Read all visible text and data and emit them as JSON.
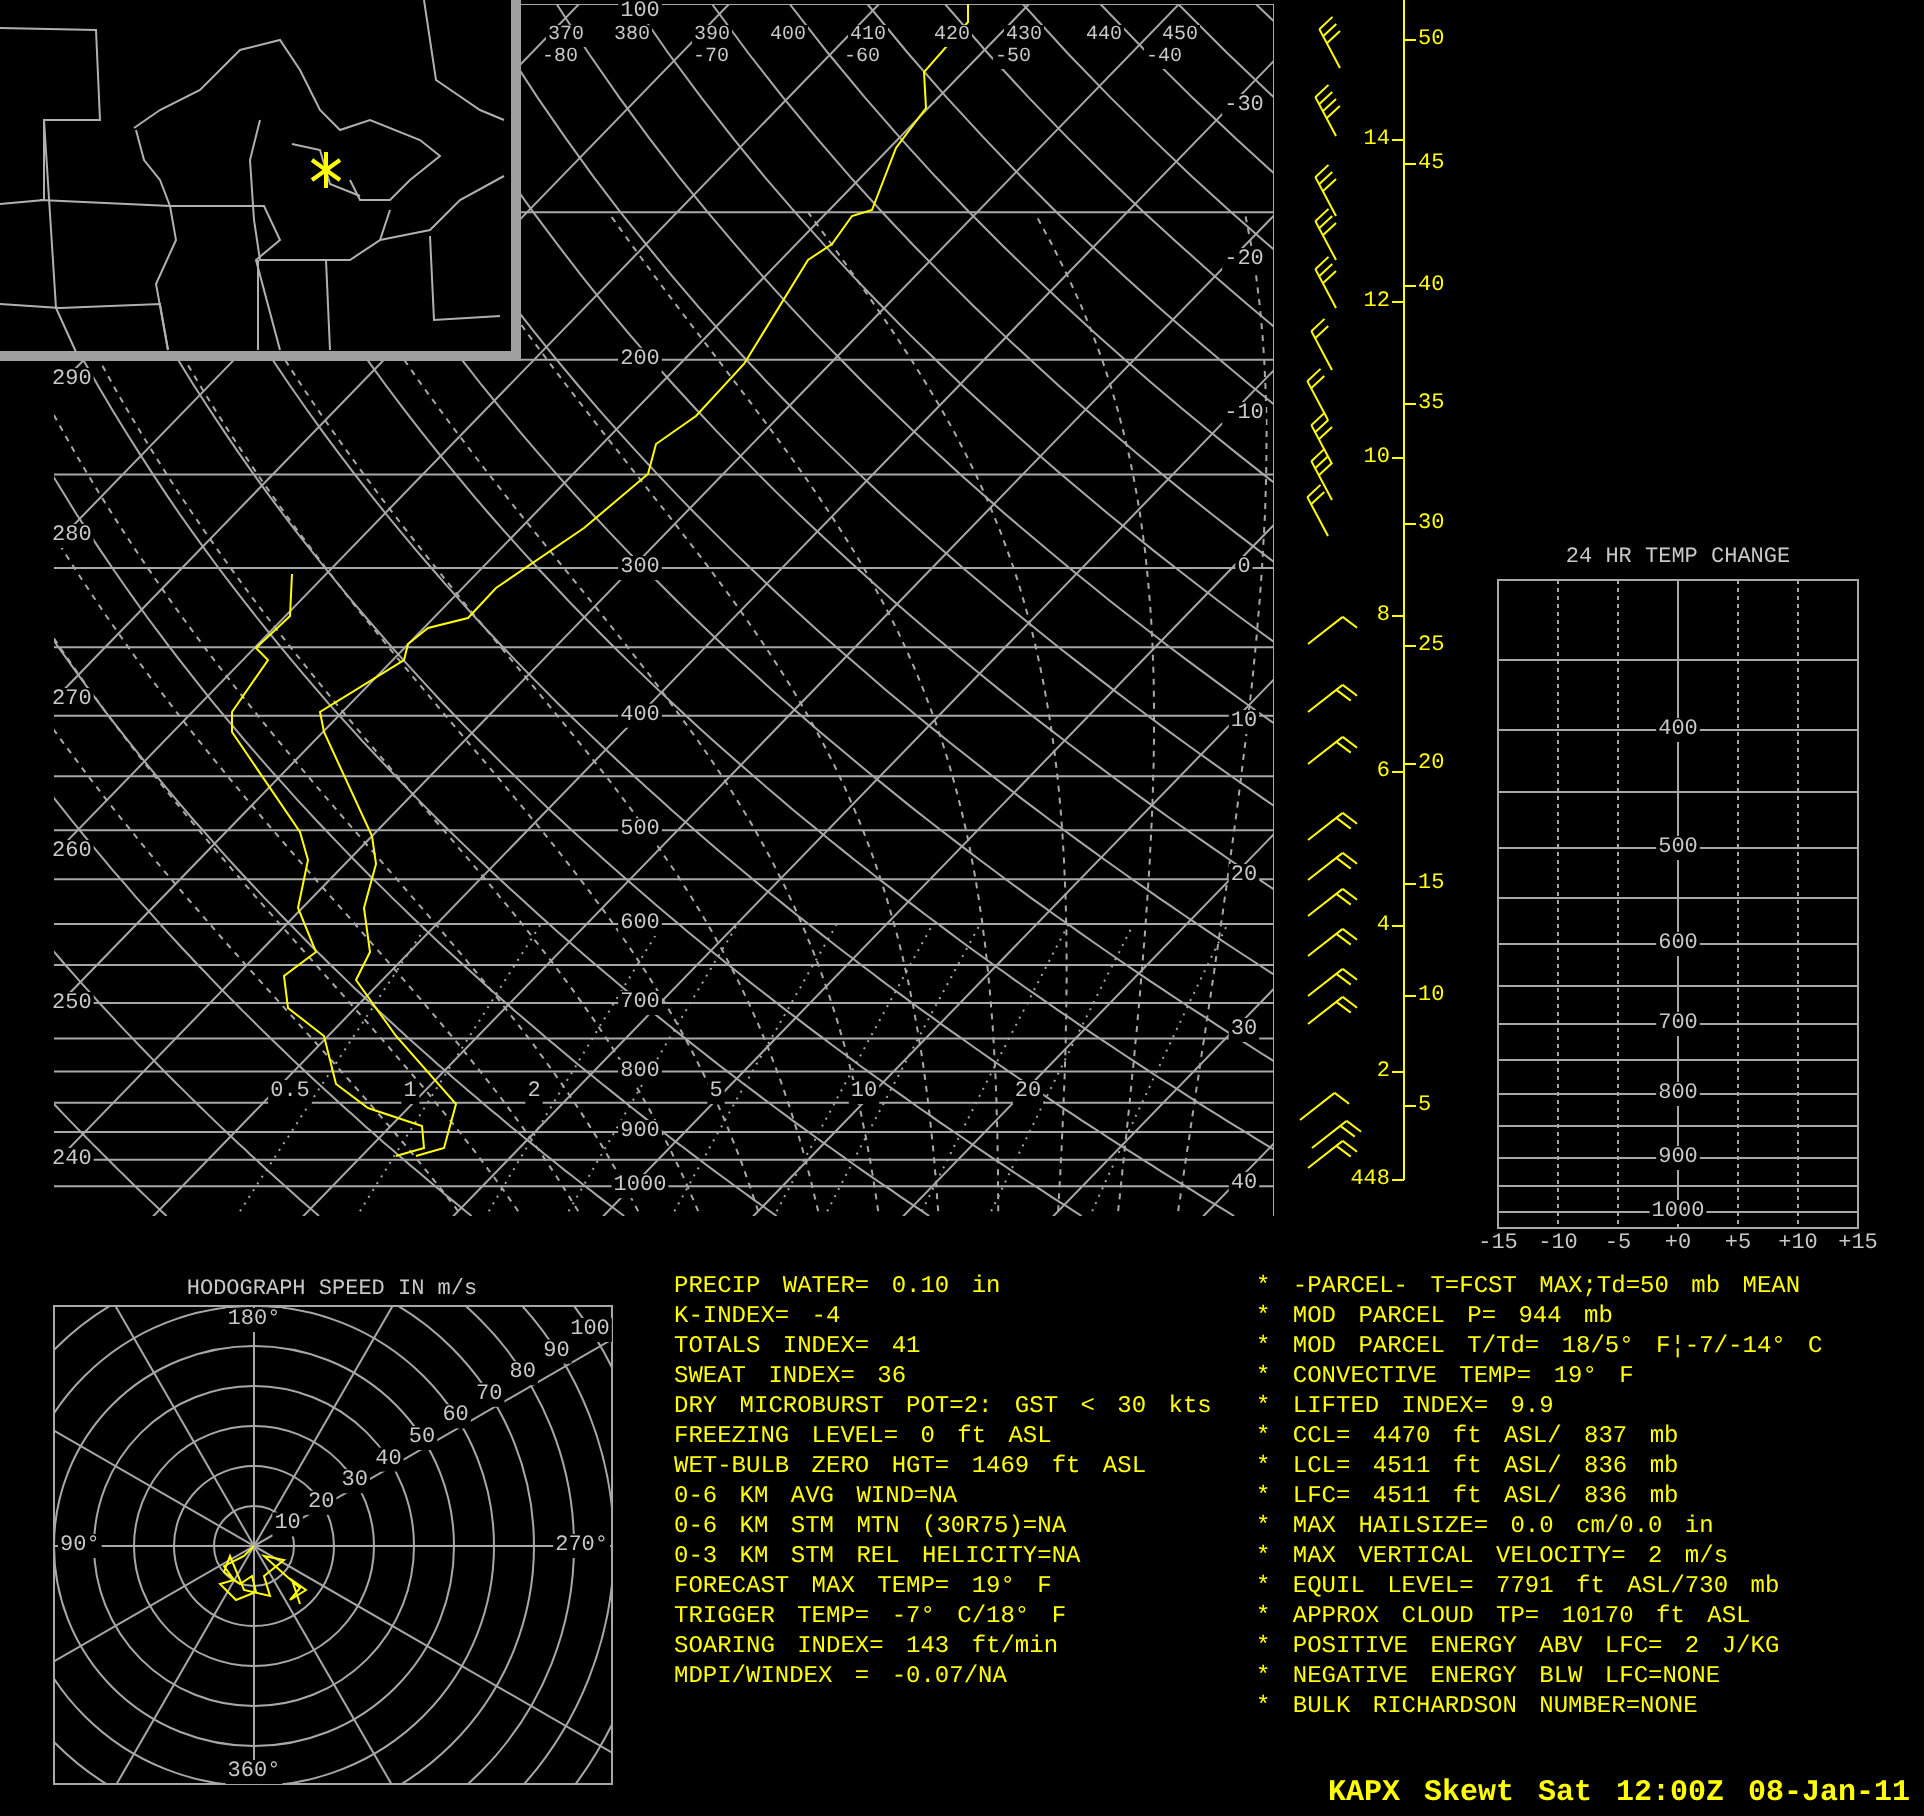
{
  "skewt": {
    "pressure_labels": [
      "100",
      "200",
      "300",
      "400",
      "500",
      "600",
      "700",
      "800",
      "900",
      "1000"
    ],
    "theta_top_labels": [
      "370",
      "380",
      "390",
      "400",
      "410",
      "420",
      "430",
      "440",
      "450"
    ],
    "theta_left_labels": [
      "290",
      "280",
      "270",
      "260",
      "250",
      "240"
    ],
    "isotherm_top_labels": [
      "-80",
      "-70",
      "-60",
      "-50",
      "-40"
    ],
    "isotherm_right_labels": [
      "-30",
      "-20",
      "-10",
      "0",
      "10",
      "20",
      "30",
      "40"
    ],
    "mixing_ratio_labels": [
      "0.5",
      "1",
      "2",
      "5",
      "10",
      "20"
    ]
  },
  "wind_axis": {
    "left_labels": [
      "14",
      "12",
      "10",
      "8",
      "6",
      "4",
      "2",
      "448"
    ],
    "right_labels": [
      "50",
      "45",
      "40",
      "35",
      "30",
      "25",
      "20",
      "15",
      "10",
      "5"
    ]
  },
  "temp_change": {
    "title": "24 HR TEMP CHANGE",
    "pressure_labels": [
      "400",
      "500",
      "600",
      "700",
      "800",
      "900",
      "1000"
    ],
    "x_labels": [
      "-15",
      "-10",
      "-5",
      "+0",
      "+5",
      "+10",
      "+15"
    ]
  },
  "hodograph": {
    "title": "HODOGRAPH SPEED IN m/s",
    "direction_labels": [
      "180°",
      "90°",
      "270°",
      "360°"
    ],
    "speed_labels": [
      "10",
      "20",
      "30",
      "40",
      "50",
      "60",
      "70",
      "80",
      "90",
      "100"
    ]
  },
  "stats_left": [
    "PRECIP WATER= 0.10 in",
    "K-INDEX= -4",
    "TOTALS INDEX= 41",
    "SWEAT INDEX= 36",
    "DRY MICROBURST POT=2: GST < 30 kts",
    "FREEZING LEVEL= 0 ft ASL",
    "WET-BULB ZERO HGT= 1469 ft ASL",
    "0-6 KM AVG WIND=NA",
    "0-6 KM STM MTN (30R75)=NA",
    "0-3 KM STM REL HELICITY=NA",
    "FORECAST MAX TEMP= 19° F",
    "TRIGGER TEMP= -7° C/18° F",
    "SOARING INDEX= 143 ft/min",
    "MDPI/WINDEX = -0.07/NA"
  ],
  "stats_right": [
    "* -PARCEL- T=FCST MAX;Td=50 mb MEAN",
    "* MOD PARCEL P= 944 mb",
    "* MOD PARCEL T/Td= 18/5° F¦-7/-14° C",
    "* CONVECTIVE TEMP= 19° F",
    "* LIFTED INDEX= 9.9",
    "* CCL= 4470 ft ASL/ 837 mb",
    "* LCL= 4511 ft ASL/ 836 mb",
    "* LFC= 4511 ft ASL/ 836 mb",
    "* MAX HAILSIZE= 0.0 cm/0.0 in",
    "* MAX VERTICAL VELOCITY= 2 m/s",
    "* EQUIL LEVEL= 7791 ft ASL/730 mb",
    "* APPROX CLOUD TP= 10170 ft ASL",
    "* POSITIVE ENERGY ABV LFC= 2 J/KG",
    "* NEGATIVE ENERGY BLW LFC=NONE",
    "* BULK RICHARDSON NUMBER=NONE"
  ],
  "footer": "KAPX Skewt Sat 12:00Z 08-Jan-11"
}
